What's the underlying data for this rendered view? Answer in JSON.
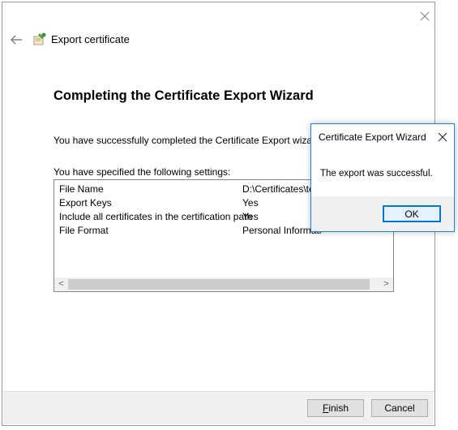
{
  "wizard": {
    "nav_title": "Export certificate",
    "heading": "Completing the Certificate Export Wizard",
    "success_text": "You have successfully completed the Certificate Export wizard.",
    "settings_label": "You have specified the following settings:",
    "settings": [
      {
        "key": "File Name",
        "value": "D:\\Certificates\\te"
      },
      {
        "key": "Export Keys",
        "value": "Yes"
      },
      {
        "key": "Include all certificates in the certification path",
        "value": "Yes"
      },
      {
        "key": "File Format",
        "value": "Personal Informati"
      }
    ],
    "scroll_left": "<",
    "scroll_right": ">",
    "finish_label": "Finish",
    "finish_mnemonic": "F",
    "finish_rest": "inish",
    "cancel_label": "Cancel"
  },
  "dialog": {
    "title": "Certificate Export Wizard",
    "message": "The export was successful.",
    "ok_label": "OK"
  },
  "colors": {
    "accent": "#0078d7",
    "dialog_border": "#1883d7",
    "footer_bg": "#f0f0f0"
  }
}
